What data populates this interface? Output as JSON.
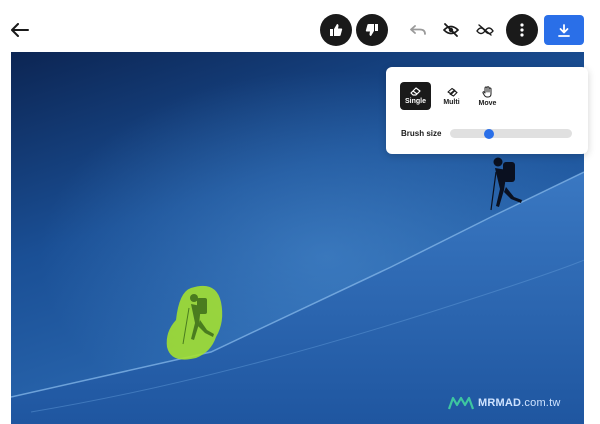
{
  "toolbar": {
    "back_icon": "arrow-left-icon",
    "like_icon": "thumbs-up-icon",
    "dislike_icon": "thumbs-down-icon",
    "undo_icon": "undo-icon",
    "hide_icon": "eye-off-icon",
    "compare_icon": "compare-icon",
    "more_icon": "more-vertical-icon",
    "download_icon": "download-icon"
  },
  "tools": {
    "single_label": "Single",
    "multi_label": "Multi",
    "move_label": "Move",
    "active": "Single"
  },
  "brush": {
    "label": "Brush size",
    "value": 0.3
  },
  "watermark": {
    "brand": "MRMAD",
    "domain": ".com.tw"
  },
  "colors": {
    "accent": "#2a6fe8",
    "mask": "#a6e22e"
  }
}
